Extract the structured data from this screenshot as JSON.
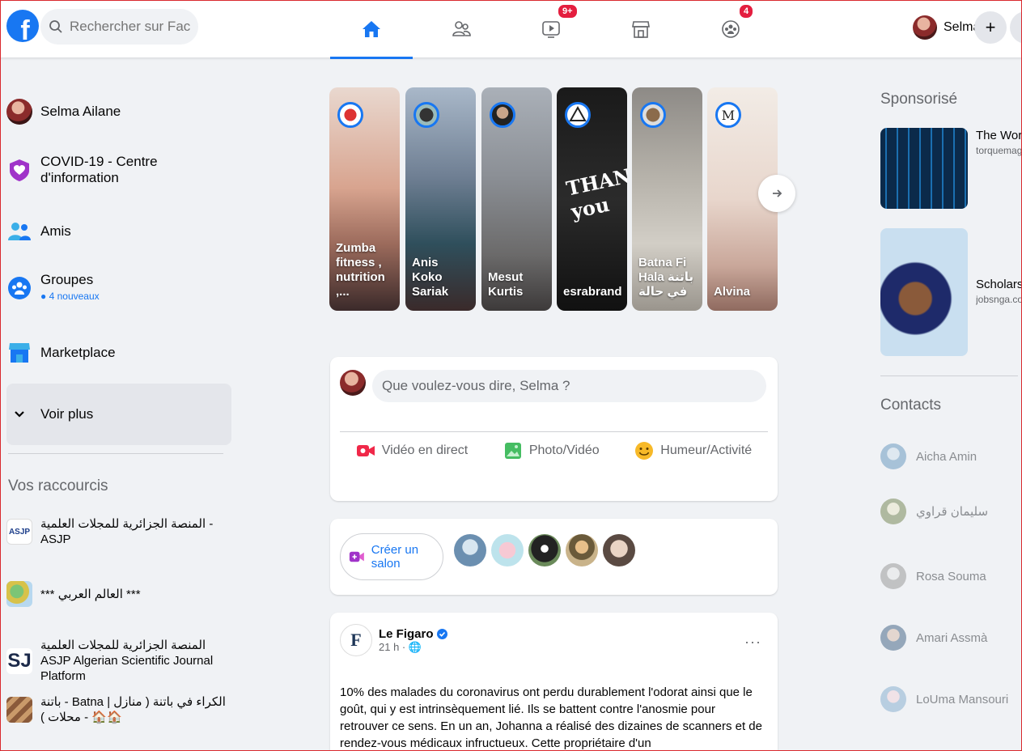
{
  "topbar": {
    "search_placeholder": "Rechercher sur Facebook",
    "video_badge": "9+",
    "groups_badge": "4",
    "profile_name": "Selma",
    "plus": "+",
    "accent": "#1877f2",
    "badge_color": "#e41e3f"
  },
  "sidebar": {
    "items": [
      {
        "label": "Selma Ailane",
        "icon": "profile-avatar"
      },
      {
        "label": "COVID-19 - Centre d'information",
        "icon": "covid-heart-icon"
      },
      {
        "label": "Amis",
        "icon": "friends-icon"
      },
      {
        "label": "Groupes",
        "sub": "● 4 nouveaux",
        "icon": "groups-icon"
      },
      {
        "label": "Marketplace",
        "icon": "marketplace-icon"
      },
      {
        "label": "Voir plus",
        "icon": "chevron-down-icon"
      }
    ],
    "shortcuts_title": "Vos raccourcis",
    "shortcuts": [
      {
        "label": "المنصة الجزائرية للمجلات العلمية - ASJP"
      },
      {
        "label": "*** العالم العربي ***"
      },
      {
        "label": "المنصة الجزائرية للمجلات العلمية ASJP Algerian Scientific Journal Platform"
      },
      {
        "label": "باتنة - Batna | الكراء في باتنة ( منازل - محلات ) 🏠🏠"
      }
    ]
  },
  "stories": [
    {
      "name": "Zumba fitness , nutrition ,..."
    },
    {
      "name": "Anis Koko Sariak"
    },
    {
      "name": "Mesut Kurtis"
    },
    {
      "name": "esrabrand"
    },
    {
      "name": "Batna Fi Hala باتنة في حالة"
    },
    {
      "name": "Alvina"
    }
  ],
  "composer": {
    "placeholder": "Que voulez-vous dire, Selma ?",
    "actions": [
      "Vidéo en direct",
      "Photo/Vidéo",
      "Humeur/Activité"
    ]
  },
  "rooms": {
    "create_label": "Créer un salon"
  },
  "post": {
    "page_name": "Le Figaro",
    "time": "21 h · 🌐",
    "dots": "···",
    "text": "10% des malades du coronavirus ont perdu durablement l'odorat ainsi que le goût, qui y est intrinsèquement lié. Ils se battent contre l'anosmie pour retrouver ce sens. En un an, Johanna a réalisé des dizaines de scanners et de rendez-vous médicaux infructueux. Cette propriétaire d'un"
  },
  "right": {
    "sponsored_title": "Sponsorisé",
    "ads": [
      {
        "title": "The Worl Develope Creating",
        "domain": "torquemag"
      },
      {
        "title": "Scholarsh",
        "domain": "jobsnga.co"
      }
    ],
    "contacts_title": "Contacts",
    "contacts": [
      "Aicha Amin",
      "سليمان قراوي",
      "Rosa Souma",
      "Amari Assmà",
      "LoUma Mansouri"
    ]
  }
}
